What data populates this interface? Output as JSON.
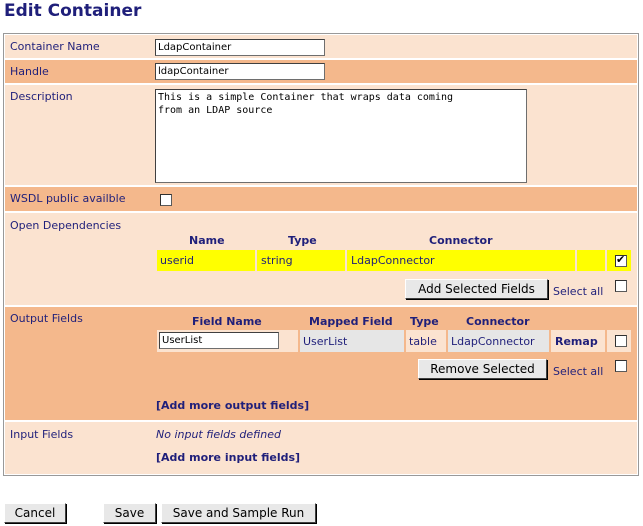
{
  "page": {
    "title": "Edit Container"
  },
  "container_name": {
    "label": "Container Name",
    "value": "LdapContainer"
  },
  "handle": {
    "label": "Handle",
    "value": "ldapContainer"
  },
  "description": {
    "label": "Description",
    "value": "This is a simple Container that wraps data coming\nfrom an LDAP source"
  },
  "wsdl": {
    "label": "WSDL public availble",
    "checked": false
  },
  "open_dependencies": {
    "label": "Open Dependencies",
    "headers": {
      "name": "Name",
      "type": "Type",
      "connector": "Connector"
    },
    "rows": [
      {
        "name": "userid",
        "type": "string",
        "connector": "LdapConnector",
        "checked": true
      }
    ],
    "add_button": "Add Selected Fields",
    "select_all": "Select all"
  },
  "output_fields": {
    "label": "Output Fields",
    "headers": {
      "field_name": "Field Name",
      "mapped_field": "Mapped Field",
      "type": "Type",
      "connector": "Connector"
    },
    "rows": [
      {
        "field_name": "UserList",
        "mapped_field": "UserList",
        "type": "table",
        "connector": "LdapConnector",
        "remap": "Remap",
        "checked": false
      }
    ],
    "remove_button": "Remove Selected",
    "select_all": "Select all",
    "add_more": "[Add more output fields]"
  },
  "input_fields": {
    "label": "Input Fields",
    "empty_text": "No input fields defined",
    "add_more": "[Add more input fields]"
  },
  "actions": {
    "cancel": "Cancel",
    "save": "Save",
    "save_run": "Save and Sample Run"
  }
}
